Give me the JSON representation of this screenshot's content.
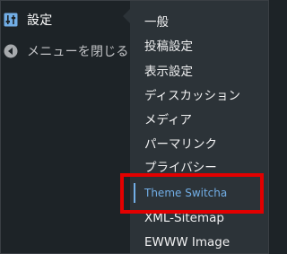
{
  "sidebar": {
    "current": {
      "label": "設定",
      "icon": "settings-sliders-icon"
    },
    "collapse": {
      "label": "メニューを閉じる",
      "icon": "collapse-arrow-circle-icon"
    }
  },
  "submenu": {
    "items": [
      {
        "label": "一般"
      },
      {
        "label": "投稿設定"
      },
      {
        "label": "表示設定"
      },
      {
        "label": "ディスカッション"
      },
      {
        "label": "メディア"
      },
      {
        "label": "パーマリンク"
      },
      {
        "label": "プライバシー"
      },
      {
        "label": "Theme Switcha",
        "current": true
      },
      {
        "label": "XML-Sitemap"
      },
      {
        "label": "EWWW Image"
      }
    ]
  },
  "colors": {
    "sidebar_bg": "#1d2327",
    "submenu_bg": "#2c3338",
    "active_link": "#72aee6",
    "highlight_border": "#e30000"
  }
}
